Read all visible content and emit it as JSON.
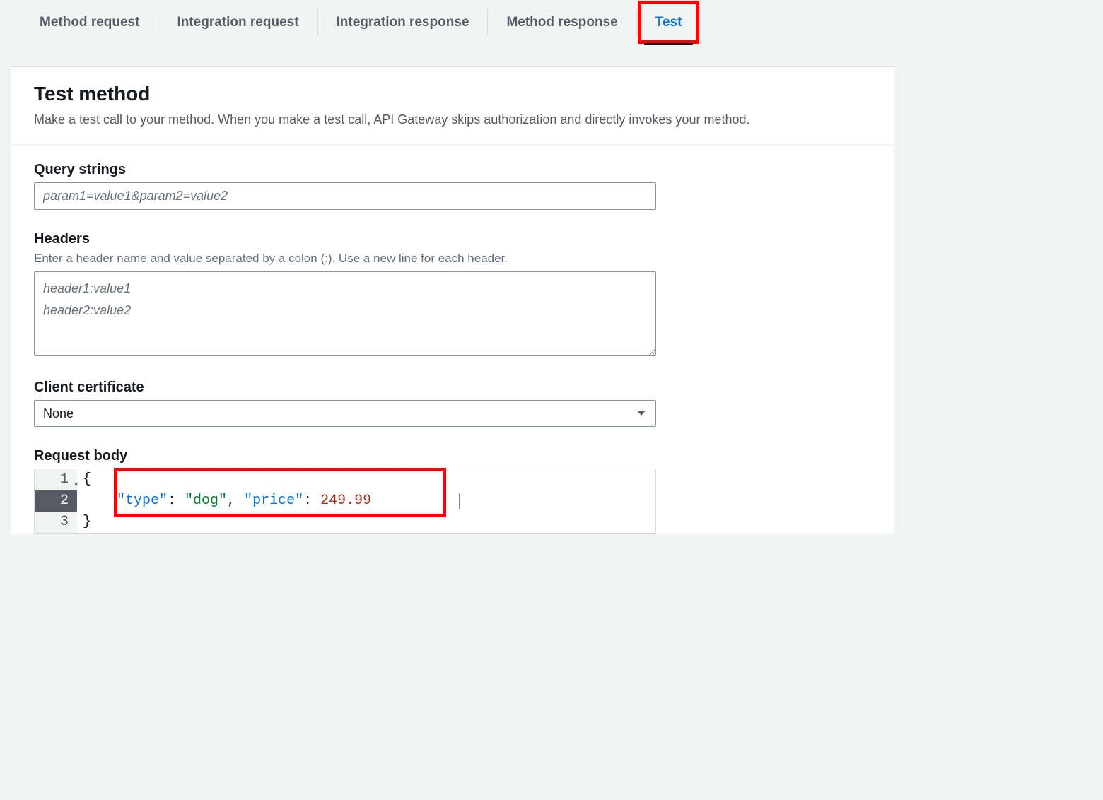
{
  "tabs": [
    {
      "label": "Method request",
      "active": false,
      "highlighted": false
    },
    {
      "label": "Integration request",
      "active": false,
      "highlighted": false
    },
    {
      "label": "Integration response",
      "active": false,
      "highlighted": false
    },
    {
      "label": "Method response",
      "active": false,
      "highlighted": false
    },
    {
      "label": "Test",
      "active": true,
      "highlighted": true
    }
  ],
  "header": {
    "title": "Test method",
    "description": "Make a test call to your method. When you make a test call, API Gateway skips authorization and directly invokes your method."
  },
  "form": {
    "query_strings": {
      "label": "Query strings",
      "placeholder": "param1=value1&param2=value2",
      "value": ""
    },
    "headers": {
      "label": "Headers",
      "hint": "Enter a header name and value separated by a colon (:). Use a new line for each header.",
      "placeholder": "header1:value1\nheader2:value2",
      "value": ""
    },
    "client_certificate": {
      "label": "Client certificate",
      "selected": "None"
    },
    "request_body": {
      "label": "Request body",
      "lines": [
        {
          "n": "1",
          "fold": true,
          "tokens": [
            {
              "t": "{",
              "c": "brace"
            }
          ]
        },
        {
          "n": "2",
          "active": true,
          "indent": "    ",
          "tokens": [
            {
              "t": "\"type\"",
              "c": "key"
            },
            {
              "t": ": ",
              "c": "punct"
            },
            {
              "t": "\"dog\"",
              "c": "str"
            },
            {
              "t": ", ",
              "c": "punct"
            },
            {
              "t": "\"price\"",
              "c": "key"
            },
            {
              "t": ": ",
              "c": "punct"
            },
            {
              "t": "249.99",
              "c": "num"
            }
          ]
        },
        {
          "n": "3",
          "tokens": [
            {
              "t": "}",
              "c": "brace"
            }
          ]
        }
      ]
    }
  }
}
